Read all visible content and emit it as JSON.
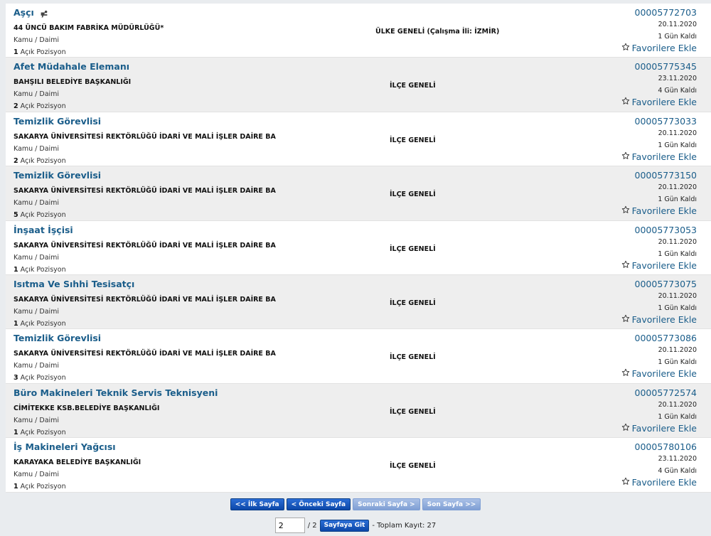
{
  "listings": [
    {
      "title": "Aşçı",
      "employer": "44 ÜNCÜ BAKIM FABRİKA MÜDÜRLÜĞÜ*",
      "type": "Kamu / Daimi",
      "positions": "1",
      "positions_label": "Açık Pozisyon",
      "location": "ÜLKE GENELİ (Çalışma İli: İZMİR)",
      "code": "00005772703",
      "date": "20.11.2020",
      "remaining": "1 Gün Kaldı",
      "fav": "Favorilere Ekle"
    },
    {
      "title": "Afet Müdahale Elemanı",
      "employer": "BAHŞILI BELEDİYE BAŞKANLIĞI",
      "type": "Kamu / Daimi",
      "positions": "2",
      "positions_label": "Açık Pozisyon",
      "location": "İLÇE GENELİ",
      "code": "00005775345",
      "date": "23.11.2020",
      "remaining": "4 Gün Kaldı",
      "fav": "Favorilere Ekle"
    },
    {
      "title": "Temizlik Görevlisi",
      "employer": "SAKARYA ÜNİVERSİTESİ REKTÖRLÜĞÜ İDARİ VE MALİ İŞLER DAİRE BA",
      "type": "Kamu / Daimi",
      "positions": "2",
      "positions_label": "Açık Pozisyon",
      "location": "İLÇE GENELİ",
      "code": "00005773033",
      "date": "20.11.2020",
      "remaining": "1 Gün Kaldı",
      "fav": "Favorilere Ekle"
    },
    {
      "title": "Temizlik Görevlisi",
      "employer": "SAKARYA ÜNİVERSİTESİ REKTÖRLÜĞÜ İDARİ VE MALİ İŞLER DAİRE BA",
      "type": "Kamu / Daimi",
      "positions": "5",
      "positions_label": "Açık Pozisyon",
      "location": "İLÇE GENELİ",
      "code": "00005773150",
      "date": "20.11.2020",
      "remaining": "1 Gün Kaldı",
      "fav": "Favorilere Ekle"
    },
    {
      "title": "İnşaat İşçisi",
      "employer": "SAKARYA ÜNİVERSİTESİ REKTÖRLÜĞÜ İDARİ VE MALİ İŞLER DAİRE BA",
      "type": "Kamu / Daimi",
      "positions": "1",
      "positions_label": "Açık Pozisyon",
      "location": "İLÇE GENELİ",
      "code": "00005773053",
      "date": "20.11.2020",
      "remaining": "1 Gün Kaldı",
      "fav": "Favorilere Ekle"
    },
    {
      "title": "Isıtma Ve Sıhhi Tesisatçı",
      "employer": "SAKARYA ÜNİVERSİTESİ REKTÖRLÜĞÜ İDARİ VE MALİ İŞLER DAİRE BA",
      "type": "Kamu / Daimi",
      "positions": "1",
      "positions_label": "Açık Pozisyon",
      "location": "İLÇE GENELİ",
      "code": "00005773075",
      "date": "20.11.2020",
      "remaining": "1 Gün Kaldı",
      "fav": "Favorilere Ekle"
    },
    {
      "title": "Temizlik Görevlisi",
      "employer": "SAKARYA ÜNİVERSİTESİ REKTÖRLÜĞÜ İDARİ VE MALİ İŞLER DAİRE BA",
      "type": "Kamu / Daimi",
      "positions": "3",
      "positions_label": "Açık Pozisyon",
      "location": "İLÇE GENELİ",
      "code": "00005773086",
      "date": "20.11.2020",
      "remaining": "1 Gün Kaldı",
      "fav": "Favorilere Ekle"
    },
    {
      "title": "Büro Makineleri Teknik Servis Teknisyeni",
      "employer": "CİMİTEKKE KSB.BELEDİYE BAŞKANLIĞI",
      "type": "Kamu / Daimi",
      "positions": "1",
      "positions_label": "Açık Pozisyon",
      "location": "İLÇE GENELİ",
      "code": "00005772574",
      "date": "20.11.2020",
      "remaining": "1 Gün Kaldı",
      "fav": "Favorilere Ekle"
    },
    {
      "title": "İş Makineleri Yağcısı",
      "employer": "KARAYAKA BELEDİYE BAŞKANLIĞI",
      "type": "Kamu / Daimi",
      "positions": "1",
      "positions_label": "Açık Pozisyon",
      "location": "İLÇE GENELİ",
      "code": "00005780106",
      "date": "23.11.2020",
      "remaining": "4 Gün Kaldı",
      "fav": "Favorilere Ekle"
    }
  ],
  "pager": {
    "first": "<< İlk Sayfa",
    "prev": "< Önceki Sayfa",
    "next": "Sonraki Sayfa >",
    "last": "Son Sayfa >>",
    "page_value": "2",
    "total_pages": "/ 2",
    "go_label": "Sayfaya Git",
    "total_label": "- Toplam Kayıt: 27"
  },
  "colors": {
    "link": "#1a5d8a",
    "button": "#0c47a8",
    "button_disabled": "#8fabd9"
  }
}
